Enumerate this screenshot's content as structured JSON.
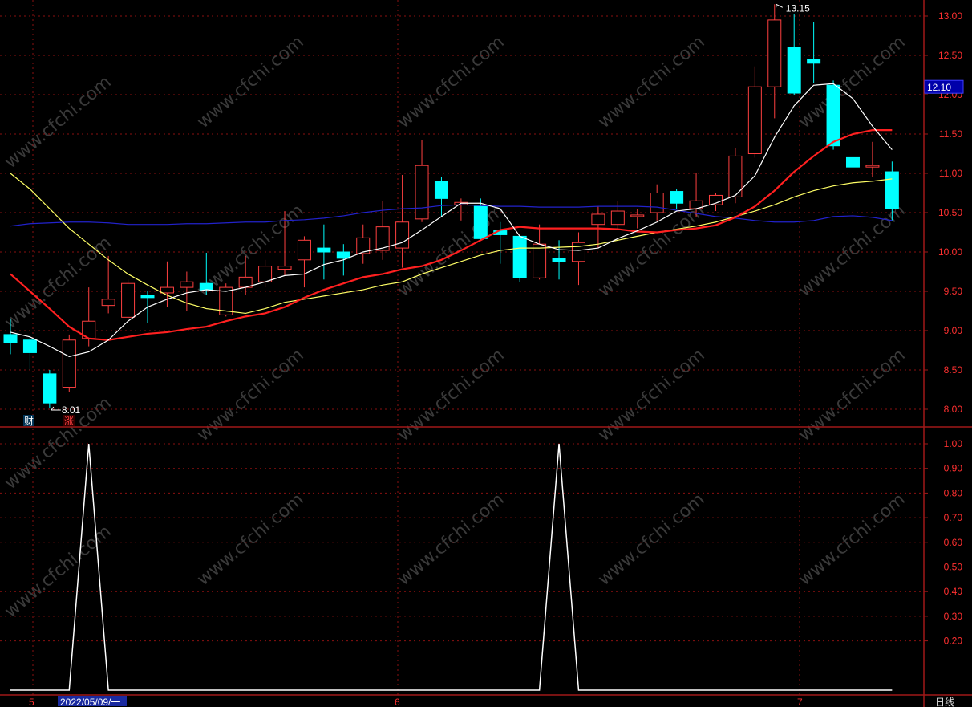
{
  "colors": {
    "background": "#000000",
    "grid": "#8a1010",
    "axis": "#a01818",
    "up_candle": "#ff4040",
    "down_candle": "#00ffff",
    "ma5": "#ffffff",
    "ma10": "#ff2020",
    "ma20": "#ffff66",
    "ma60": "#2222cc",
    "indicator": "#ffffff",
    "tick_text": "#ff3030",
    "current_price_bg": "#0000aa"
  },
  "watermark": "www.cfchi.com",
  "price_panel": {
    "y_ticks": [
      "13.00",
      "12.50",
      "12.00",
      "11.50",
      "11.00",
      "10.50",
      "10.00",
      "9.50",
      "9.00",
      "8.50",
      "8.00"
    ],
    "ylim": [
      7.8,
      13.2
    ],
    "current_price": "12.10",
    "high_label": "13.15",
    "low_label": "8.01",
    "event_markers": [
      "财",
      "涨"
    ]
  },
  "indicator_panel": {
    "y_ticks": [
      "1.00",
      "0.90",
      "0.80",
      "0.70",
      "0.60",
      "0.50",
      "0.40",
      "0.30",
      "0.20"
    ],
    "ylim": [
      -0.05,
      1.0
    ]
  },
  "x_axis": {
    "labels": [
      "5",
      "2022/05/09/一",
      "6",
      "7"
    ],
    "period_label": "日线"
  },
  "chart_data": {
    "type": "candlestick",
    "candles": [
      {
        "o": 8.95,
        "h": 9.15,
        "l": 8.7,
        "c": 8.85
      },
      {
        "o": 8.88,
        "h": 8.95,
        "l": 8.5,
        "c": 8.72
      },
      {
        "o": 8.45,
        "h": 8.5,
        "l": 8.01,
        "c": 8.08
      },
      {
        "o": 8.28,
        "h": 8.95,
        "l": 8.22,
        "c": 8.88
      },
      {
        "o": 8.9,
        "h": 9.55,
        "l": 8.8,
        "c": 9.12
      },
      {
        "o": 9.32,
        "h": 9.95,
        "l": 9.22,
        "c": 9.4
      },
      {
        "o": 9.17,
        "h": 9.65,
        "l": 9.15,
        "c": 9.6
      },
      {
        "o": 9.45,
        "h": 9.5,
        "l": 9.1,
        "c": 9.42
      },
      {
        "o": 9.48,
        "h": 9.88,
        "l": 9.3,
        "c": 9.55
      },
      {
        "o": 9.55,
        "h": 9.75,
        "l": 9.25,
        "c": 9.62
      },
      {
        "o": 9.6,
        "h": 9.99,
        "l": 9.45,
        "c": 9.52
      },
      {
        "o": 9.2,
        "h": 9.6,
        "l": 9.18,
        "c": 9.55
      },
      {
        "o": 9.55,
        "h": 9.95,
        "l": 9.45,
        "c": 9.68
      },
      {
        "o": 9.62,
        "h": 9.9,
        "l": 9.55,
        "c": 9.82
      },
      {
        "o": 9.78,
        "h": 10.52,
        "l": 9.7,
        "c": 9.82
      },
      {
        "o": 9.9,
        "h": 10.2,
        "l": 9.55,
        "c": 10.15
      },
      {
        "o": 10.05,
        "h": 10.35,
        "l": 9.65,
        "c": 10.0
      },
      {
        "o": 10.0,
        "h": 10.1,
        "l": 9.7,
        "c": 9.92
      },
      {
        "o": 9.98,
        "h": 10.35,
        "l": 9.85,
        "c": 10.18
      },
      {
        "o": 10.02,
        "h": 10.65,
        "l": 9.9,
        "c": 10.32
      },
      {
        "o": 10.05,
        "h": 10.98,
        "l": 9.8,
        "c": 10.38
      },
      {
        "o": 10.42,
        "h": 11.42,
        "l": 10.38,
        "c": 11.1
      },
      {
        "o": 10.9,
        "h": 10.95,
        "l": 10.45,
        "c": 10.68
      },
      {
        "o": 10.6,
        "h": 10.68,
        "l": 10.4,
        "c": 10.63
      },
      {
        "o": 10.58,
        "h": 10.68,
        "l": 10.15,
        "c": 10.17
      },
      {
        "o": 10.27,
        "h": 10.38,
        "l": 9.85,
        "c": 10.22
      },
      {
        "o": 10.2,
        "h": 10.22,
        "l": 9.62,
        "c": 9.67
      },
      {
        "o": 9.67,
        "h": 10.35,
        "l": 9.65,
        "c": 10.1
      },
      {
        "o": 9.92,
        "h": 10.15,
        "l": 9.65,
        "c": 9.88
      },
      {
        "o": 9.88,
        "h": 10.25,
        "l": 9.58,
        "c": 10.12
      },
      {
        "o": 10.35,
        "h": 10.58,
        "l": 10.05,
        "c": 10.48
      },
      {
        "o": 10.35,
        "h": 10.65,
        "l": 10.3,
        "c": 10.52
      },
      {
        "o": 10.45,
        "h": 10.55,
        "l": 10.3,
        "c": 10.47
      },
      {
        "o": 10.5,
        "h": 10.86,
        "l": 10.4,
        "c": 10.75
      },
      {
        "o": 10.77,
        "h": 10.8,
        "l": 10.55,
        "c": 10.62
      },
      {
        "o": 10.55,
        "h": 11.0,
        "l": 10.45,
        "c": 10.65
      },
      {
        "o": 10.6,
        "h": 10.75,
        "l": 10.52,
        "c": 10.72
      },
      {
        "o": 10.7,
        "h": 11.32,
        "l": 10.62,
        "c": 11.22
      },
      {
        "o": 11.25,
        "h": 12.36,
        "l": 11.2,
        "c": 12.1
      },
      {
        "o": 12.1,
        "h": 13.15,
        "l": 11.7,
        "c": 12.95
      },
      {
        "o": 12.6,
        "h": 13.02,
        "l": 12.0,
        "c": 12.02
      },
      {
        "o": 12.45,
        "h": 12.92,
        "l": 12.15,
        "c": 12.4
      },
      {
        "o": 12.12,
        "h": 12.18,
        "l": 11.3,
        "c": 11.35
      },
      {
        "o": 11.2,
        "h": 11.5,
        "l": 11.05,
        "c": 11.08
      },
      {
        "o": 11.08,
        "h": 11.4,
        "l": 10.95,
        "c": 11.1
      },
      {
        "o": 11.02,
        "h": 11.15,
        "l": 10.4,
        "c": 10.55
      }
    ],
    "ma5": [
      8.98,
      8.92,
      8.8,
      8.67,
      8.73,
      8.88,
      9.12,
      9.3,
      9.4,
      9.48,
      9.52,
      9.5,
      9.55,
      9.62,
      9.7,
      9.72,
      9.84,
      9.9,
      10.0,
      10.05,
      10.12,
      10.28,
      10.45,
      10.62,
      10.62,
      10.55,
      10.2,
      10.1,
      10.03,
      10.02,
      10.05,
      10.17,
      10.27,
      10.38,
      10.52,
      10.55,
      10.62,
      10.72,
      10.97,
      11.46,
      11.86,
      12.12,
      12.14,
      11.95,
      11.6,
      11.3
    ],
    "ma10": [
      9.72,
      9.5,
      9.28,
      9.05,
      8.9,
      8.88,
      8.92,
      8.96,
      8.98,
      9.02,
      9.05,
      9.12,
      9.18,
      9.22,
      9.3,
      9.42,
      9.52,
      9.6,
      9.68,
      9.72,
      9.78,
      9.82,
      9.9,
      10.02,
      10.15,
      10.28,
      10.32,
      10.3,
      10.3,
      10.3,
      10.3,
      10.29,
      10.26,
      10.25,
      10.28,
      10.3,
      10.34,
      10.44,
      10.58,
      10.78,
      11.02,
      11.22,
      11.4,
      11.5,
      11.55,
      11.55
    ],
    "ma20": [
      11.0,
      10.8,
      10.55,
      10.3,
      10.1,
      9.9,
      9.72,
      9.58,
      9.45,
      9.35,
      9.28,
      9.25,
      9.22,
      9.28,
      9.36,
      9.4,
      9.44,
      9.48,
      9.52,
      9.58,
      9.62,
      9.72,
      9.8,
      9.88,
      9.96,
      10.02,
      10.05,
      10.05,
      10.06,
      10.07,
      10.1,
      10.15,
      10.2,
      10.25,
      10.29,
      10.33,
      10.38,
      10.45,
      10.52,
      10.6,
      10.7,
      10.78,
      10.84,
      10.88,
      10.9,
      10.93
    ],
    "ma60": [
      10.33,
      10.36,
      10.37,
      10.38,
      10.38,
      10.37,
      10.35,
      10.35,
      10.35,
      10.36,
      10.36,
      10.37,
      10.38,
      10.38,
      10.4,
      10.41,
      10.43,
      10.46,
      10.5,
      10.53,
      10.55,
      10.56,
      10.59,
      10.6,
      10.59,
      10.58,
      10.58,
      10.57,
      10.57,
      10.57,
      10.58,
      10.58,
      10.58,
      10.57,
      10.53,
      10.49,
      10.45,
      10.43,
      10.4,
      10.38,
      10.38,
      10.4,
      10.45,
      10.46,
      10.44,
      10.4
    ],
    "indicator": [
      0,
      0,
      0,
      0,
      1,
      0,
      0,
      0,
      0,
      0,
      0,
      0,
      0,
      0,
      0,
      0,
      0,
      0,
      0,
      0,
      0,
      0,
      0,
      0,
      0,
      0,
      0,
      0,
      1,
      0,
      0,
      0,
      0,
      0,
      0,
      0,
      0,
      0,
      0,
      0,
      0,
      0,
      0,
      0,
      0,
      0
    ]
  }
}
